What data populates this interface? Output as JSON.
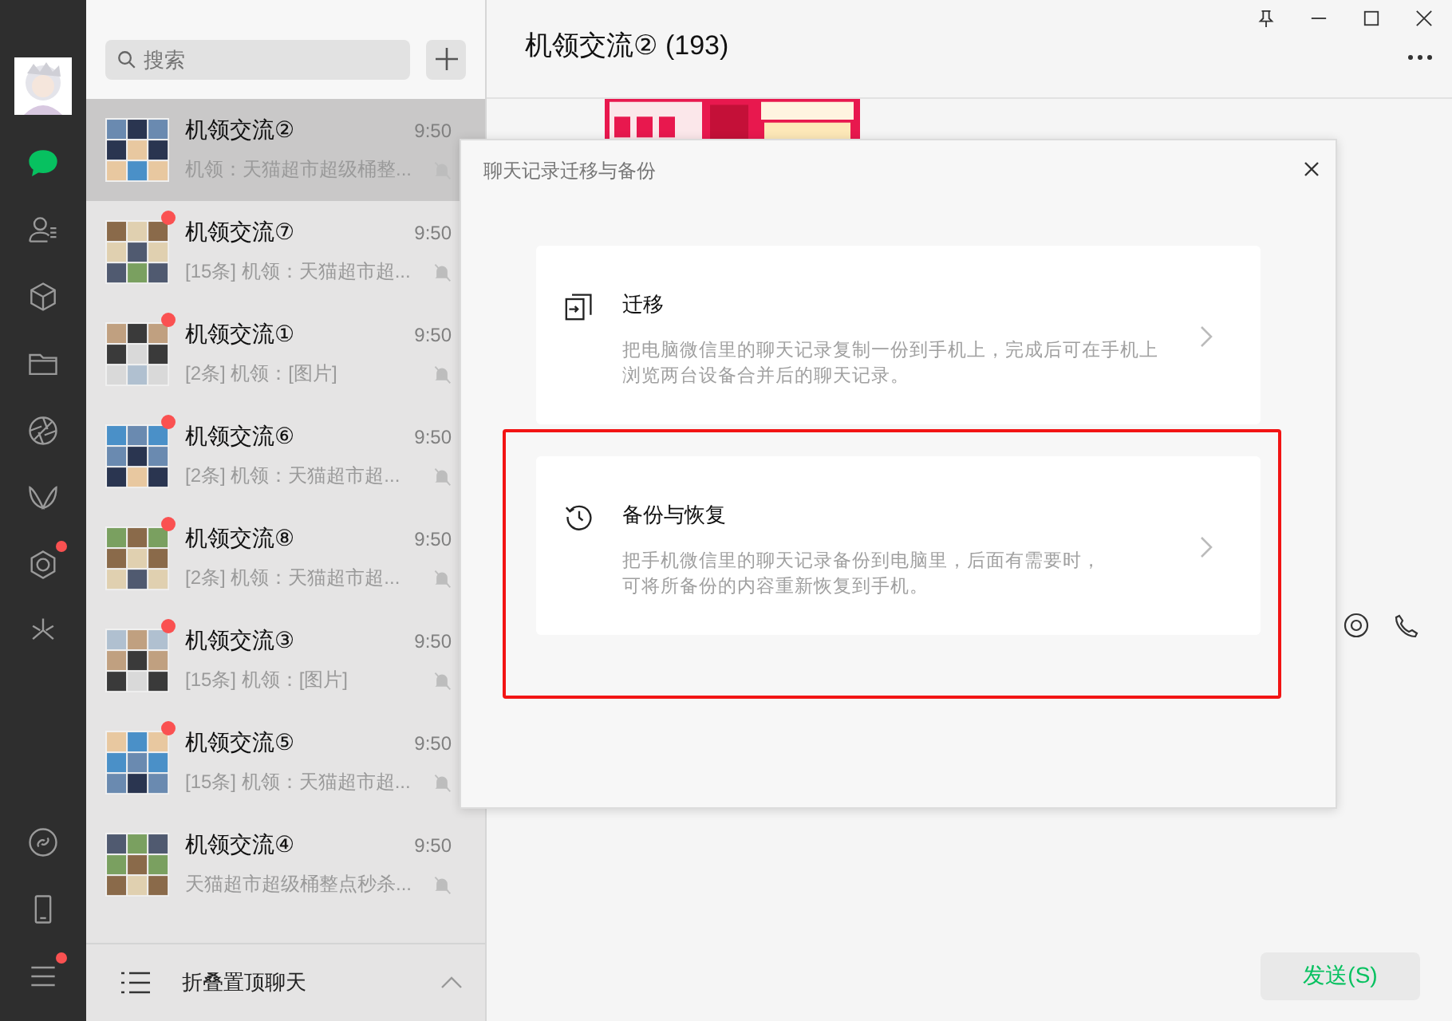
{
  "sidebar": {
    "items": [
      {
        "kind": "chat",
        "selected": true,
        "dot": false
      },
      {
        "kind": "contacts",
        "selected": false,
        "dot": false
      },
      {
        "kind": "box",
        "selected": false,
        "dot": false
      },
      {
        "kind": "folder",
        "selected": false,
        "dot": false
      },
      {
        "kind": "aperture",
        "selected": false,
        "dot": false
      },
      {
        "kind": "wings",
        "selected": false,
        "dot": false
      },
      {
        "kind": "hexagon",
        "selected": false,
        "dot": true
      },
      {
        "kind": "sparkle",
        "selected": false,
        "dot": false
      }
    ],
    "bottom_items": [
      {
        "kind": "link",
        "dot": false
      },
      {
        "kind": "phone",
        "dot": false
      },
      {
        "kind": "menu",
        "dot": true
      }
    ]
  },
  "chat_list": {
    "search": {
      "placeholder": "搜索"
    },
    "rows": [
      {
        "name": "机领交流②",
        "time": "9:50",
        "preview": "机领：天猫超市超级桶整...",
        "unread": false,
        "muted": true,
        "selected": true
      },
      {
        "name": "机领交流⑦",
        "time": "9:50",
        "preview": "[15条] 机领：天猫超市超...",
        "unread": true,
        "muted": true,
        "selected": false
      },
      {
        "name": "机领交流①",
        "time": "9:50",
        "preview": "[2条] 机领：[图片]",
        "unread": true,
        "muted": true,
        "selected": false
      },
      {
        "name": "机领交流⑥",
        "time": "9:50",
        "preview": "[2条] 机领：天猫超市超...",
        "unread": true,
        "muted": true,
        "selected": false
      },
      {
        "name": "机领交流⑧",
        "time": "9:50",
        "preview": "[2条] 机领：天猫超市超...",
        "unread": true,
        "muted": true,
        "selected": false
      },
      {
        "name": "机领交流③",
        "time": "9:50",
        "preview": "[15条] 机领：[图片]",
        "unread": true,
        "muted": true,
        "selected": false
      },
      {
        "name": "机领交流⑤",
        "time": "9:50",
        "preview": "[15条] 机领：天猫超市超...",
        "unread": true,
        "muted": true,
        "selected": false
      },
      {
        "name": "机领交流④",
        "time": "9:50",
        "preview": "天猫超市超级桶整点秒杀...",
        "unread": false,
        "muted": true,
        "selected": false
      }
    ],
    "footer": "折叠置顶聊天"
  },
  "chat": {
    "title": "机领交流② (193)",
    "send_button": "发送(S)"
  },
  "dialog": {
    "title": "聊天记录迁移与备份",
    "options": [
      {
        "kind": "migrate",
        "title": "迁移",
        "lines": [
          "把电脑微信里的聊天记录复制一份到手机上，完成后可在手机上浏览两台设备合并后的聊天记录。"
        ],
        "highlighted": false
      },
      {
        "kind": "backup",
        "title": "备份与恢复",
        "lines": [
          "把手机微信里的聊天记录备份到电脑里，后面有需要时，",
          "可将所备份的内容重新恢复到手机。"
        ],
        "highlighted": true
      }
    ]
  }
}
